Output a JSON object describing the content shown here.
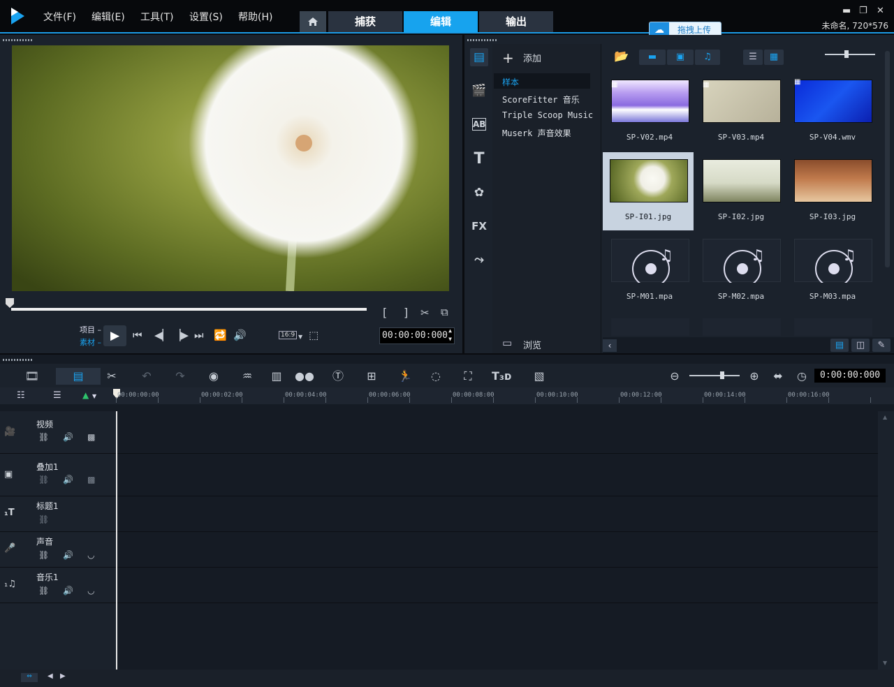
{
  "menu": [
    "文件(F)",
    "编辑(E)",
    "工具(T)",
    "设置(S)",
    "帮助(H)"
  ],
  "tabs": {
    "capture": "捕获",
    "edit": "编辑",
    "output": "输出"
  },
  "upload_label": "拖拽上传",
  "project_info": "未命名, 720*576",
  "player": {
    "mode_project": "项目",
    "mode_clip": "素材",
    "aspect": "16:9",
    "timecode": "00:00:00:000"
  },
  "library": {
    "add_label": "添加",
    "browse_label": "浏览",
    "folders": [
      "样本",
      "ScoreFitter 音乐",
      "Triple Scoop Music",
      "Muserk 声音效果"
    ],
    "items": [
      {
        "name": "SP-V02.mp4"
      },
      {
        "name": "SP-V03.mp4"
      },
      {
        "name": "SP-V04.wmv"
      },
      {
        "name": "SP-I01.jpg"
      },
      {
        "name": "SP-I02.jpg"
      },
      {
        "name": "SP-I03.jpg"
      },
      {
        "name": "SP-M01.mpa"
      },
      {
        "name": "SP-M02.mpa"
      },
      {
        "name": "SP-M03.mpa"
      }
    ]
  },
  "timeline": {
    "timecode": "0:00:00:000",
    "ruler": [
      "00:00:00:00",
      "00:00:02:00",
      "00:00:04:00",
      "00:00:06:00",
      "00:00:08:00",
      "00:00:10:00",
      "00:00:12:00",
      "00:00:14:00",
      "00:00:16:00"
    ],
    "tracks": [
      "视频",
      "叠加1",
      "标题1",
      "声音",
      "音乐1"
    ]
  }
}
